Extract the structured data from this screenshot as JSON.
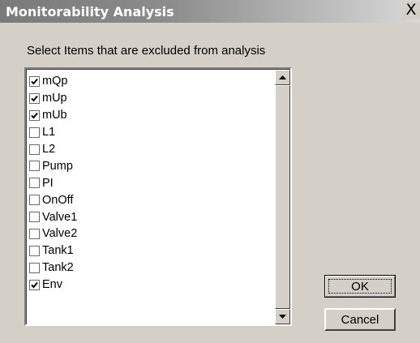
{
  "window": {
    "title": "Monitorability Analysis",
    "close_glyph": "X"
  },
  "instruction": "Select Items that are excluded from analysis",
  "items": [
    {
      "label": "mQp",
      "checked": true
    },
    {
      "label": "mUp",
      "checked": true
    },
    {
      "label": "mUb",
      "checked": true
    },
    {
      "label": "L1",
      "checked": false
    },
    {
      "label": "L2",
      "checked": false
    },
    {
      "label": "Pump",
      "checked": false
    },
    {
      "label": "PI",
      "checked": false
    },
    {
      "label": "OnOff",
      "checked": false
    },
    {
      "label": "Valve1",
      "checked": false
    },
    {
      "label": "Valve2",
      "checked": false
    },
    {
      "label": "Tank1",
      "checked": false
    },
    {
      "label": "Tank2",
      "checked": false
    },
    {
      "label": "Env",
      "checked": true
    }
  ],
  "buttons": {
    "ok": "OK",
    "cancel": "Cancel"
  },
  "icons": {
    "close": "close-icon",
    "check": "checkmark-icon",
    "up": "arrow-up-icon",
    "down": "arrow-down-icon"
  }
}
